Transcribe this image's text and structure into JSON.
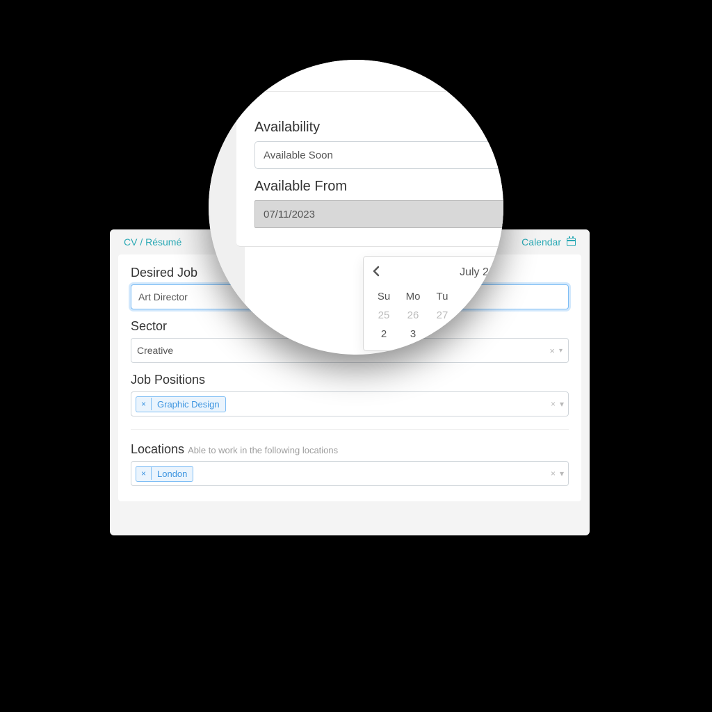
{
  "nav": {
    "left_link": "CV / Résumé",
    "right_link": "Calendar"
  },
  "form": {
    "desired_job": {
      "label": "Desired Job",
      "value": "Art Director"
    },
    "sector": {
      "label": "Sector",
      "value": "Creative"
    },
    "job_positions": {
      "label": "Job Positions",
      "tags": [
        "Graphic Design"
      ]
    },
    "locations": {
      "label": "Locations",
      "hint": "Able to work in the following locations",
      "tags": [
        "London"
      ]
    }
  },
  "lens": {
    "availability": {
      "label": "Availability",
      "value": "Available Soon"
    },
    "available_from": {
      "label": "Available From",
      "value": "07/11/2023"
    },
    "calendar": {
      "month_label": "July 2",
      "dow": [
        "Su",
        "Mo",
        "Tu"
      ],
      "row1": [
        "25",
        "26",
        "27"
      ],
      "row2": [
        "2",
        "3"
      ]
    }
  },
  "select_controls": {
    "clear": "×",
    "arrow": "▾"
  },
  "tag_controls": {
    "remove": "×"
  }
}
